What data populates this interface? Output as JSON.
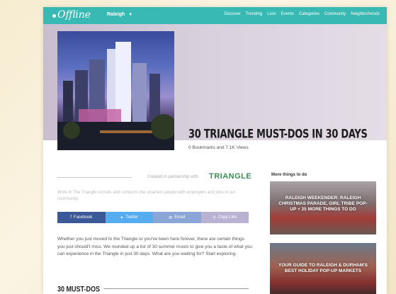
{
  "nav": {
    "logo": "Offline",
    "city": "Raleigh",
    "links": [
      "Discover",
      "Trending",
      "Lists",
      "Events",
      "Categories",
      "Community",
      "Neighborhoods"
    ]
  },
  "article": {
    "title": "30 TRIANGLE MUST-DOS IN 30 DAYS",
    "stats": "0 Bookmarks and 7.1K Views",
    "partner_text": "Created in partnership with",
    "partner_logo": "TRIANGLE",
    "partner_desc": "Work In The Triangle recruits and connects the smartest people with employers and jobs in our community.",
    "share": {
      "facebook": "Facebook",
      "twitter": "Twitter",
      "email": "Email",
      "copy_link": "Copy Link"
    },
    "body": "Whether you just moved to the Triangle or you've been here forever, there are certain things you just should't miss. We rounded up a list of 30 summer musts to give you a taste of what you can experience in the Triangle in just 30 days. What are you waiting for? Start exploring.",
    "section_title": "30 MUST-DOS"
  },
  "sidebar": {
    "heading": "More things to do",
    "cards": [
      {
        "title": "RALEIGH WEEKENDER: RALEIGH CHRISTMAS PARADE, GIRL TRIBE POP-UP + 25 MORE THINGS TO DO"
      },
      {
        "title": "YOUR GUIDE TO RALEIGH & DURHAM'S BEST HOLIDAY POP-UP MARKETS"
      }
    ]
  },
  "colors": {
    "nav": "#39b9b3",
    "facebook": "#3b5998",
    "twitter": "#55acee",
    "email": "#8aa6d6",
    "copy_link": "#b9b2d2"
  }
}
